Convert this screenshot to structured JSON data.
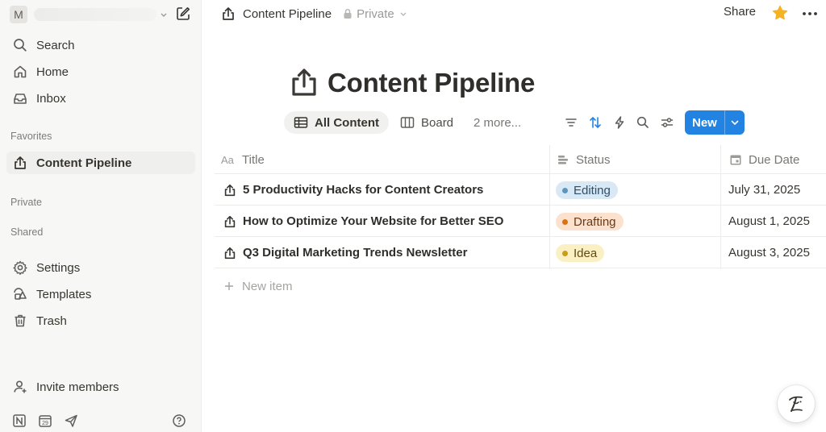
{
  "sidebar": {
    "workspace_initial": "M",
    "workspace_name": "",
    "nav": [
      {
        "label": "Search",
        "icon": "search-icon"
      },
      {
        "label": "Home",
        "icon": "home-icon"
      },
      {
        "label": "Inbox",
        "icon": "inbox-icon"
      }
    ],
    "favorites_label": "Favorites",
    "favorites": [
      {
        "label": "Content Pipeline",
        "icon": "share-page-icon"
      }
    ],
    "private_label": "Private",
    "shared_label": "Shared",
    "tools": [
      {
        "label": "Settings",
        "icon": "gear-icon"
      },
      {
        "label": "Templates",
        "icon": "templates-icon"
      },
      {
        "label": "Trash",
        "icon": "trash-icon"
      }
    ],
    "invite_label": "Invite members",
    "bottom_icons": [
      "notion-icon",
      "calendar-icon",
      "send-icon",
      "help-icon"
    ],
    "calendar_day": "29"
  },
  "topbar": {
    "page_name": "Content Pipeline",
    "privacy": "Private",
    "share_label": "Share"
  },
  "page": {
    "title": "Content Pipeline"
  },
  "views": {
    "tabs": [
      {
        "label": "All Content",
        "icon": "table-icon",
        "active": true
      },
      {
        "label": "Board",
        "icon": "board-icon",
        "active": false
      }
    ],
    "more_label": "2 more...",
    "toolbar_icons": [
      "filter-icon",
      "sort-icon",
      "automation-icon",
      "search-icon",
      "settings-sliders-icon"
    ],
    "new_label": "New"
  },
  "table": {
    "columns": [
      {
        "label": "Title",
        "icon": "text-property-icon"
      },
      {
        "label": "Status",
        "icon": "status-property-icon"
      },
      {
        "label": "Due Date",
        "icon": "date-property-icon"
      }
    ],
    "rows": [
      {
        "title": "5 Productivity Hacks for Content Creators",
        "status": "Editing",
        "due": "July 31, 2025"
      },
      {
        "title": "How to Optimize Your Website for Better SEO",
        "status": "Drafting",
        "due": "August 1, 2025"
      },
      {
        "title": "Q3 Digital Marketing Trends Newsletter",
        "status": "Idea",
        "due": "August 3, 2025"
      }
    ],
    "new_item_label": "New item"
  },
  "colors": {
    "accent": "#2383e2",
    "star": "#f5b324",
    "editing_bg": "#d8e8f4",
    "editing_dot": "#5b97bd",
    "drafting_bg": "#fbe1ce",
    "drafting_dot": "#d9730d",
    "idea_bg": "#fbf0c4",
    "idea_dot": "#cb9b1c"
  }
}
